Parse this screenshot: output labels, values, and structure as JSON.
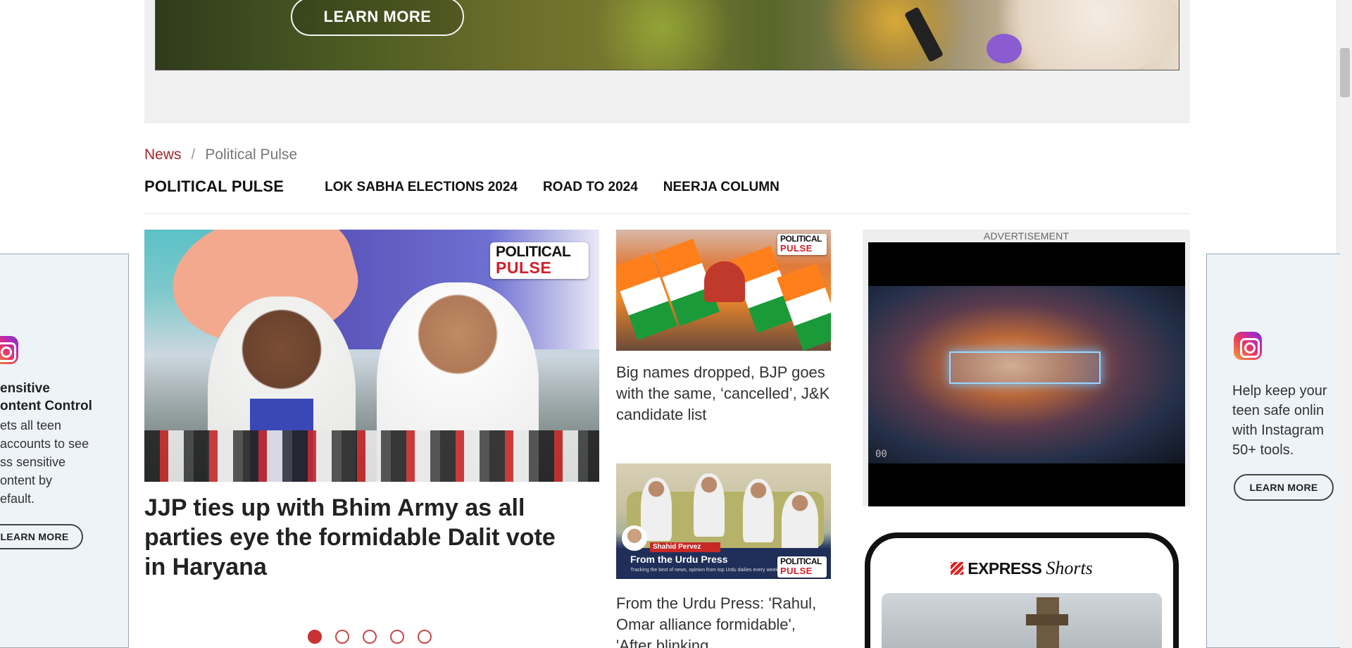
{
  "top_ad": {
    "button_label": "LEARN MORE"
  },
  "breadcrumb": {
    "items": [
      "News",
      "Political Pulse"
    ],
    "separator": "/"
  },
  "section_nav": {
    "title": "POLITICAL PULSE",
    "links": [
      "LOK SABHA ELECTIONS 2024",
      "ROAD TO 2024",
      "NEERJA COLUMN"
    ]
  },
  "main_story": {
    "headline": "JJP ties up with Bhim Army as all parties eye the formidable Dalit vote in Haryana",
    "badge_line1": "POLITICAL",
    "badge_line2": "PULSE",
    "carousel_total": 5,
    "carousel_active": 1
  },
  "side_stories": [
    {
      "title": "Big names dropped, BJP goes with the same, ‘cancelled’, J&K candidate list",
      "badge_line1": "POLITICAL",
      "badge_line2": "PULSE"
    },
    {
      "title": "From the Urdu Press: 'Rahul, Omar alliance formidable', 'After blinking",
      "image_caption_name": "Shahid Pervez",
      "image_caption_title": "From the Urdu Press",
      "image_caption_sub": "Tracking the best of news, opinion from top Urdu dailies every week",
      "badge_line1": "POLITICAL",
      "badge_line2": "PULSE"
    }
  ],
  "right_ad": {
    "label": "ADVERTISEMENT",
    "video_timestamp": "00"
  },
  "express_shorts": {
    "brand": "EXPRESS",
    "product": "Shorts"
  },
  "left_side_ad": {
    "heading": "ensitive\nontent Control",
    "body": "ets all teen\naccounts to see\nss sensitive\nontent by\nefault.",
    "button": "LEARN MORE"
  },
  "right_side_ad": {
    "body": "Help keep your\nteen safe onlin\nwith Instagram\n50+ tools.",
    "button": "LEARN MORE"
  },
  "colors": {
    "breadcrumb_link": "#a0282a",
    "carousel_active": "#c83232",
    "text": "#222222"
  },
  "icons": [
    "instagram-icon",
    "express-logo-icon"
  ]
}
